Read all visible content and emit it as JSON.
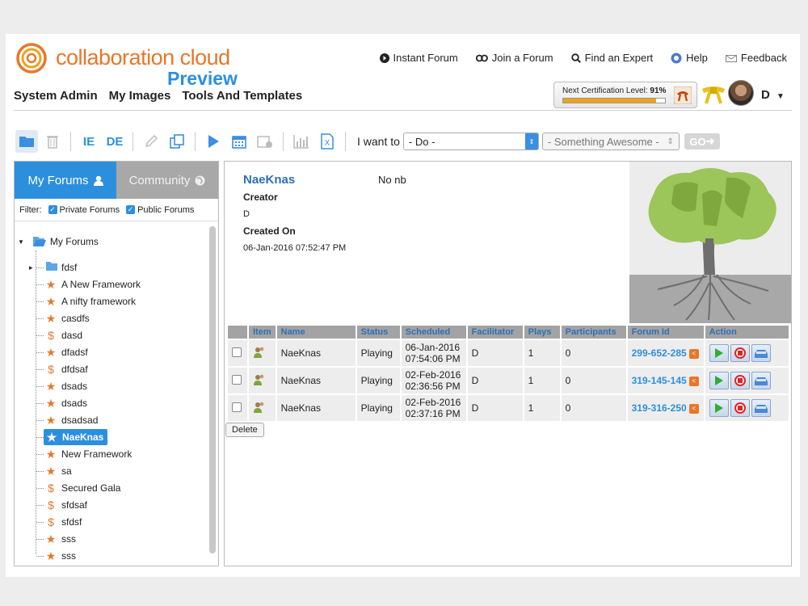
{
  "brand": {
    "name": "collaboration cloud",
    "sub": "Preview",
    "ring_color": "#e8772a",
    "accent": "#2c8fde"
  },
  "topnav": [
    {
      "label": "Instant Forum",
      "icon": "arrow-circle-icon"
    },
    {
      "label": "Join a Forum",
      "icon": "link-icon"
    },
    {
      "label": "Find an Expert",
      "icon": "search-icon"
    },
    {
      "label": "Help",
      "icon": "help-icon"
    },
    {
      "label": "Feedback",
      "icon": "envelope-icon"
    }
  ],
  "mainnav": [
    "System Admin",
    "My Images",
    "Tools And Templates"
  ],
  "certification": {
    "label": "Next Certification Level:",
    "percent_text": "91%",
    "percent": 91
  },
  "user": {
    "initial": "D",
    "caret": "▼"
  },
  "toolbar": {
    "ie": "IE",
    "de": "DE",
    "iwant_label": "I want to",
    "do_value": "- Do -",
    "something_value": "- Something Awesome -",
    "go_label": "GO"
  },
  "left": {
    "tab_my": "My Forums",
    "tab_community": "Community",
    "filter_label": "Filter:",
    "filter_private": "Private Forums",
    "filter_public": "Public Forums",
    "root": "My Forums",
    "items": [
      {
        "label": "fdsf",
        "icon": "folder-icon"
      },
      {
        "label": "A New Framework",
        "icon": "star-icon"
      },
      {
        "label": "A nifty framework",
        "icon": "star-icon"
      },
      {
        "label": "casdfs",
        "icon": "star-icon"
      },
      {
        "label": "dasd",
        "icon": "dollar-icon"
      },
      {
        "label": "dfadsf",
        "icon": "star-icon"
      },
      {
        "label": "dfdsaf",
        "icon": "dollar-icon"
      },
      {
        "label": "dsads",
        "icon": "star-icon"
      },
      {
        "label": "dsads",
        "icon": "star-icon"
      },
      {
        "label": "dsadsad",
        "icon": "star-icon"
      },
      {
        "label": "NaeKnas",
        "icon": "star-icon",
        "selected": true
      },
      {
        "label": "New Framework",
        "icon": "star-icon"
      },
      {
        "label": "sa",
        "icon": "star-icon"
      },
      {
        "label": "Secured Gala",
        "icon": "dollar-icon"
      },
      {
        "label": "sfdsaf",
        "icon": "dollar-icon"
      },
      {
        "label": "sfdsf",
        "icon": "dollar-icon"
      },
      {
        "label": "sss",
        "icon": "star-icon"
      },
      {
        "label": "sss",
        "icon": "star-icon"
      }
    ]
  },
  "detail": {
    "title": "NaeKnas",
    "description": "No nb",
    "creator_label": "Creator",
    "creator": "D",
    "created_label": "Created On",
    "created": "06-Jan-2016 07:52:47 PM"
  },
  "table": {
    "headers": [
      "",
      "Item",
      "Name",
      "Status",
      "Scheduled",
      "Facilitator",
      "Plays",
      "Participants",
      "Forum Id",
      "Action"
    ],
    "rows": [
      {
        "name": "NaeKnas",
        "status": "Playing",
        "date": "06-Jan-2016",
        "time": "07:54:06 PM",
        "facilitator": "D",
        "plays": "1",
        "participants": "0",
        "forum_id": "299-652-285"
      },
      {
        "name": "NaeKnas",
        "status": "Playing",
        "date": "02-Feb-2016",
        "time": "02:36:56 PM",
        "facilitator": "D",
        "plays": "1",
        "participants": "0",
        "forum_id": "319-145-145"
      },
      {
        "name": "NaeKnas",
        "status": "Playing",
        "date": "02-Feb-2016",
        "time": "02:37:16 PM",
        "facilitator": "D",
        "plays": "1",
        "participants": "0",
        "forum_id": "319-316-250"
      }
    ],
    "delete_label": "Delete"
  }
}
